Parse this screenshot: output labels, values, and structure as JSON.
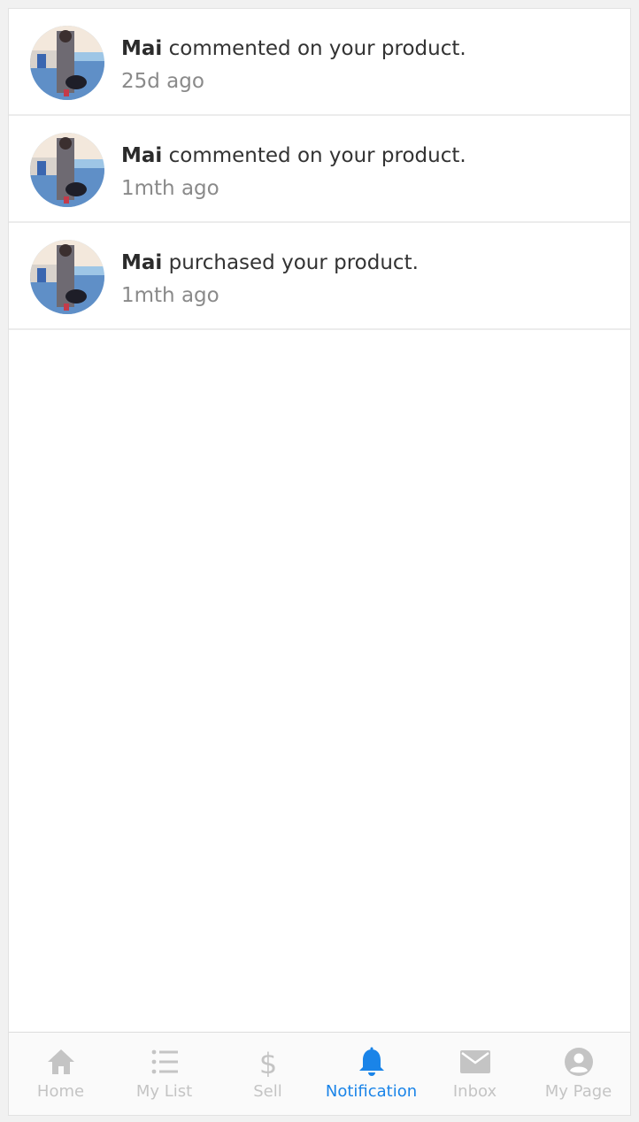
{
  "notifications": [
    {
      "user": "Mai",
      "action": "commented on your product.",
      "time": "25d ago"
    },
    {
      "user": "Mai",
      "action": "commented on your product.",
      "time": "1mth ago"
    },
    {
      "user": "Mai",
      "action": "purchased your product.",
      "time": "1mth ago"
    }
  ],
  "tabs": [
    {
      "label": "Home",
      "icon": "home-icon"
    },
    {
      "label": "My List",
      "icon": "list-icon"
    },
    {
      "label": "Sell",
      "icon": "dollar-icon"
    },
    {
      "label": "Notification",
      "icon": "bell-icon"
    },
    {
      "label": "Inbox",
      "icon": "mail-icon"
    },
    {
      "label": "My Page",
      "icon": "user-circle-icon"
    }
  ],
  "active_tab": "Notification",
  "colors": {
    "accent": "#1a84e8",
    "inactive": "#c4c4c4",
    "text": "#333333",
    "muted": "#8a8a8a"
  }
}
